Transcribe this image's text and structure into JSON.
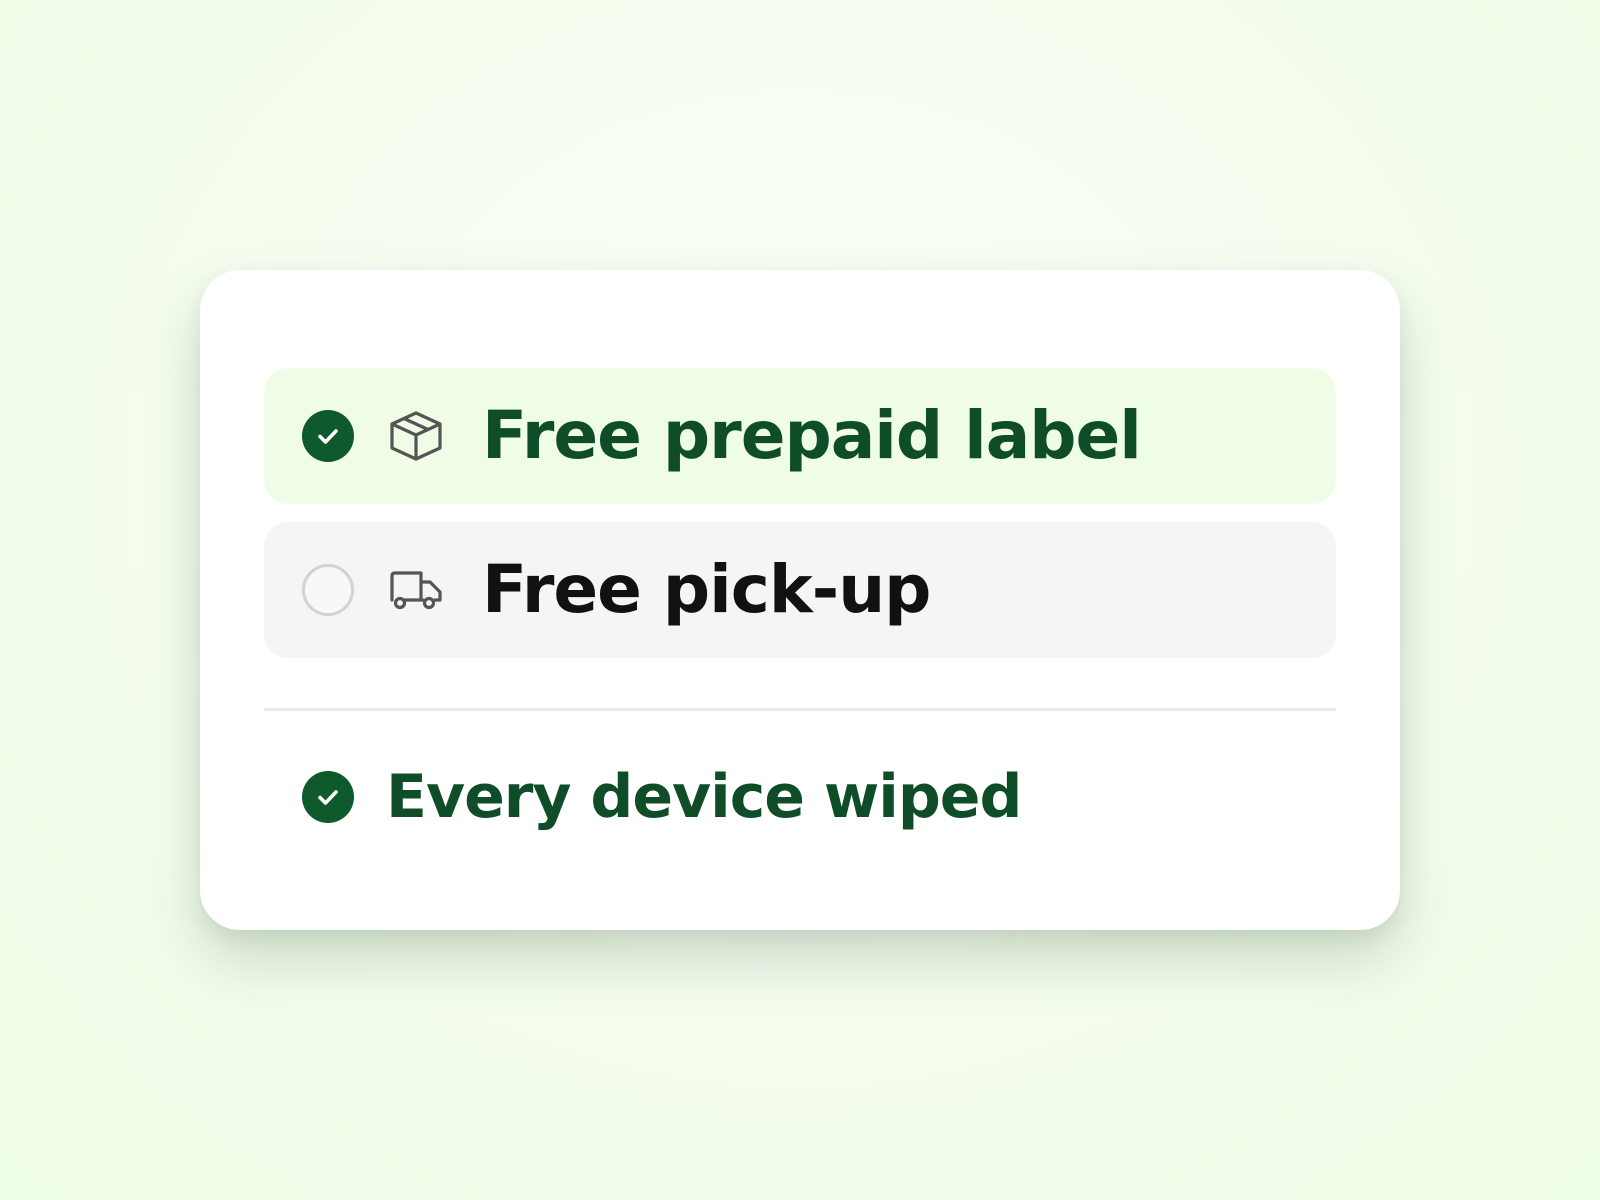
{
  "delivery_options": [
    {
      "label": "Free prepaid label",
      "icon": "box-icon",
      "selected": true
    },
    {
      "label": "Free pick-up",
      "icon": "truck-icon",
      "selected": false
    }
  ],
  "feature": {
    "label": "Every device wiped",
    "icon": "check-circle-icon"
  },
  "colors": {
    "accent": "#0f5a2c",
    "selected_bg": "#effde6",
    "unselected_bg": "#f5f5f5",
    "text_accent": "#0f4d28"
  }
}
